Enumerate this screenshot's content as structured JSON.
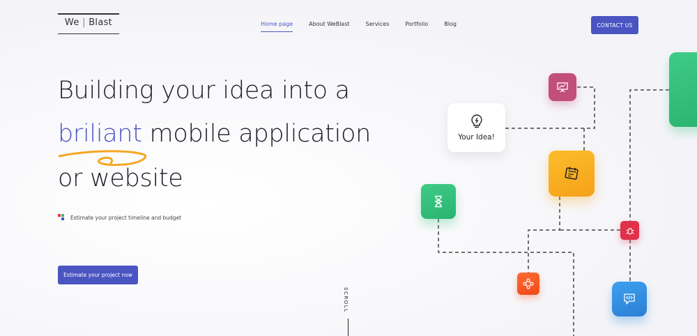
{
  "header": {
    "logo": {
      "left": "We",
      "sep": "|",
      "right": "Blast"
    },
    "nav": [
      {
        "label": "Home page",
        "active": true
      },
      {
        "label": "About WeBlast",
        "active": false
      },
      {
        "label": "Services",
        "active": false
      },
      {
        "label": "Portfolio",
        "active": false
      },
      {
        "label": "Blog",
        "active": false
      }
    ],
    "contact_label": "CONTACT US"
  },
  "hero": {
    "line1": "Building your idea into a",
    "line2_accent": "briliant",
    "line2_rest": " mobile application",
    "line3": "or website",
    "estimate_text": "Estimate your project timeline and budget",
    "cta_label": "Estimate your project now",
    "scroll_label": "SCROLL"
  },
  "diagram": {
    "idea_label": "Your Idea!",
    "tiles": [
      {
        "name": "presentation-icon",
        "color": "#c24f7a"
      },
      {
        "name": "calendar-icon",
        "color": "#f6a81c"
      },
      {
        "name": "hourglass-icon",
        "color": "#2fbf78"
      },
      {
        "name": "bug-icon",
        "color": "#e0304a"
      },
      {
        "name": "network-icon",
        "color": "#ff5a22"
      },
      {
        "name": "code-chat-icon",
        "color": "#2f8fe0"
      },
      {
        "name": "green-panel",
        "color": "#2fc07a"
      }
    ]
  },
  "colors": {
    "accent": "#4a55c2",
    "underline": "#f5a623"
  }
}
